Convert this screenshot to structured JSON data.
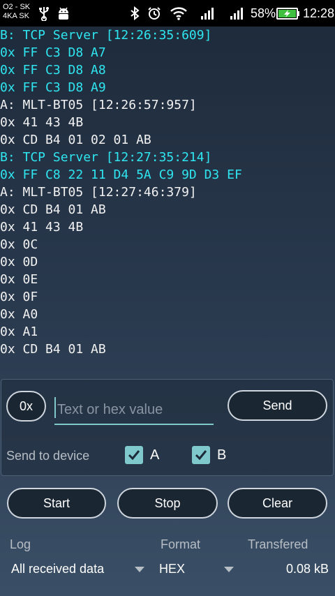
{
  "status_bar": {
    "carrier1": "O2 - SK",
    "carrier2": "4KA SK",
    "battery": "58%",
    "time": "12:28"
  },
  "log": [
    {
      "text": "B: TCP Server [12:26:35:609]",
      "kind": "srcB"
    },
    {
      "text": "0x FF C3 D8 A7",
      "kind": "dataB"
    },
    {
      "text": "0x FF C3 D8 A8",
      "kind": "dataB"
    },
    {
      "text": "0x FF C3 D8 A9",
      "kind": "dataB"
    },
    {
      "text": "A: MLT-BT05 [12:26:57:957]",
      "kind": "srcA"
    },
    {
      "text": "0x 41 43 4B",
      "kind": "data"
    },
    {
      "text": "0x CD B4 01 02 01 AB",
      "kind": "data"
    },
    {
      "text": "B: TCP Server [12:27:35:214]",
      "kind": "srcB"
    },
    {
      "text": "0x FF C8 22 11 D4 5A C9 9D D3 EF",
      "kind": "dataB"
    },
    {
      "text": "A: MLT-BT05 [12:27:46:379]",
      "kind": "srcA"
    },
    {
      "text": "0x CD B4 01 AB",
      "kind": "data"
    },
    {
      "text": "0x 41 43 4B",
      "kind": "data"
    },
    {
      "text": "0x 0C",
      "kind": "data"
    },
    {
      "text": "0x 0D",
      "kind": "data"
    },
    {
      "text": "0x 0E",
      "kind": "data"
    },
    {
      "text": "0x 0F",
      "kind": "data"
    },
    {
      "text": "0x A0",
      "kind": "data"
    },
    {
      "text": "0x A1",
      "kind": "data"
    },
    {
      "text": "0x CD B4 01 AB",
      "kind": "data"
    }
  ],
  "input": {
    "prefix_label": "0x",
    "placeholder": "Text or hex value",
    "value": "",
    "send_label": "Send"
  },
  "send_to": {
    "label": "Send to device",
    "a_label": "A",
    "a_checked": true,
    "b_label": "B",
    "b_checked": true
  },
  "actions": {
    "start_label": "Start",
    "stop_label": "Stop",
    "clear_label": "Clear"
  },
  "footer": {
    "log_header": "Log",
    "log_value": "All received data",
    "format_header": "Format",
    "format_value": "HEX",
    "transferred_header": "Transfered",
    "transferred_value": "0.08 kB"
  },
  "colors": {
    "device_b_text": "#2fe6f0",
    "accent": "#7fc9cc"
  }
}
